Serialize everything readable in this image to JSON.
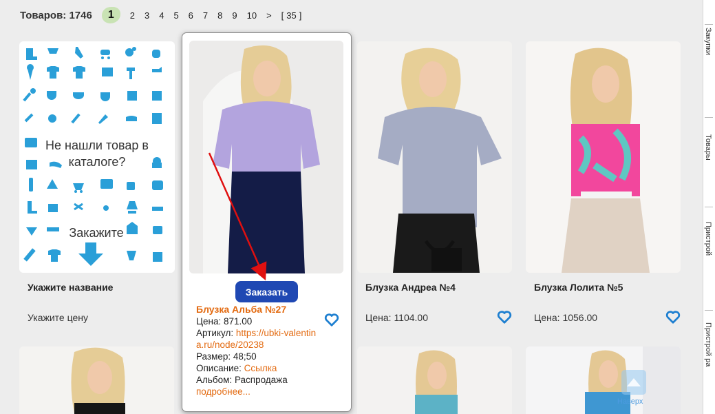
{
  "header": {
    "count_label": "Товаров: 1746",
    "pages": [
      "2",
      "3",
      "4",
      "5",
      "6",
      "7",
      "8",
      "9",
      "10",
      ">",
      "[",
      "35",
      "]"
    ],
    "current_page": "1"
  },
  "cards": [
    {
      "name": "Укажите название",
      "price": "Укажите цену"
    },
    {
      "name": "Блузка Андреа №4",
      "price": "Цена: 1104.00"
    },
    {
      "name": "Блузка Лолита №5",
      "price": "Цена: 1056.00"
    }
  ],
  "placeholder_card": {
    "line1": "Не нашли товар в",
    "line2": "каталоге?",
    "line3": "Закажите"
  },
  "popup": {
    "order_label": "Заказать",
    "name": "Блузка Альба №27",
    "price": "Цена: 871.00",
    "article_label": "Артикул:",
    "article_link_1": "https://ubki-valentin",
    "article_link_2": "a.ru/node/20238",
    "size": "Размер: 48;50",
    "desc_label": "Описание:",
    "desc_link": "Ссылка",
    "album": "Альбом: Распродажа",
    "more": "подробнее..."
  },
  "up_button": {
    "label": "Наверх"
  },
  "side_labels": [
    "Закупки",
    "Товары",
    "Пристрой",
    "Пристрой ра"
  ],
  "colors": {
    "accent": "#1f48b3",
    "link": "#e36a10",
    "heart": "#1e7fd0",
    "icon": "#2a9fd8"
  }
}
